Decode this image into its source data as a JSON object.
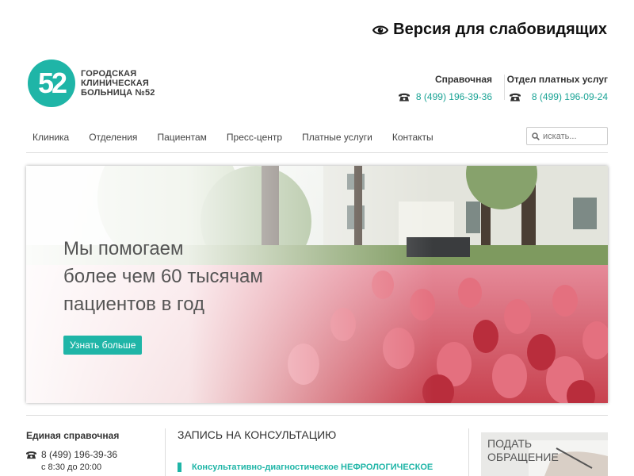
{
  "header": {
    "accessibility_label": "Версия для слабовидящих",
    "logo": {
      "mark": "52",
      "lines": [
        "ГОРОДСКАЯ",
        "КЛИНИЧЕСКАЯ",
        "БОЛЬНИЦА №52"
      ]
    },
    "contacts": [
      {
        "title": "Справочная",
        "phone": "8 (499) 196-39-36"
      },
      {
        "title": "Отдел платных услуг",
        "phone": "8 (499) 196-09-24"
      }
    ]
  },
  "nav": {
    "items": [
      "Клиника",
      "Отделения",
      "Пациентам",
      "Пресс-центр",
      "Платные услуги",
      "Контакты"
    ],
    "search_placeholder": "искать..."
  },
  "hero": {
    "lines": [
      "Мы помогаем",
      "более чем 60 тысячам",
      "пациентов в год"
    ],
    "button_label": "Узнать больше"
  },
  "footer_block": {
    "helpline": {
      "title": "Единая справочная",
      "phone": "8 (499) 196-39-36",
      "hours": "с 8:30 до 20:00"
    },
    "consultation": {
      "heading": "ЗАПИСЬ НА КОНСУЛЬТАЦИЮ",
      "item": "Консультативно-диагностическое НЕФРОЛОГИЧЕСКОЕ"
    },
    "appeal": {
      "lines": [
        "ПОДАТЬ",
        "ОБРАЩЕНИЕ"
      ]
    }
  },
  "colors": {
    "accent": "#1fb5a7",
    "text": "#333333"
  },
  "icons": {
    "accessibility": "eye-icon",
    "phone": "phone-icon",
    "search": "search-icon"
  }
}
